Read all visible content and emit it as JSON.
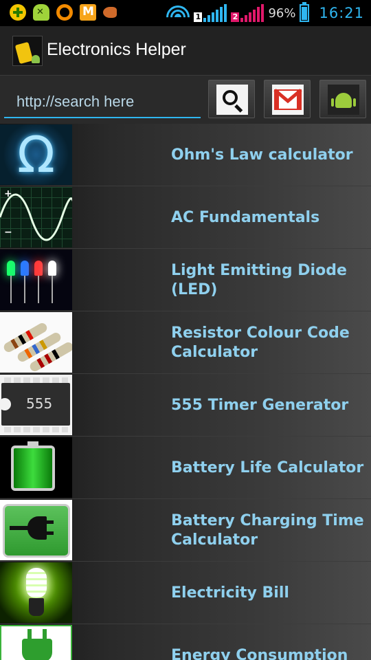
{
  "status_bar": {
    "icons": [
      "plus-icon",
      "android-debug-icon",
      "orange-ring-icon",
      "mail-icon",
      "fish-icon",
      "wifi-icon",
      "signal-1-icon",
      "signal-2-icon",
      "battery-icon"
    ],
    "sim1": "1",
    "sim2": "2",
    "battery_percent": "96%",
    "time": "16:21"
  },
  "action_bar": {
    "title": "Electronics Helper"
  },
  "search": {
    "placeholder": "http://search here",
    "value": ""
  },
  "toolbar_icons": [
    "search-icon",
    "gmail-icon",
    "android-icon"
  ],
  "list": [
    {
      "label": "Ohm's Law calculator",
      "icon": "omega-icon"
    },
    {
      "label": "AC Fundamentals",
      "icon": "sine-wave-icon"
    },
    {
      "label": "Light Emitting Diode (LED)",
      "icon": "led-icon"
    },
    {
      "label": "Resistor Colour Code Calculator",
      "icon": "resistor-icon"
    },
    {
      "label": "555 Timer Generator",
      "icon": "chip-555-icon",
      "chip_text": "555"
    },
    {
      "label": "Battery Life Calculator",
      "icon": "battery-icon"
    },
    {
      "label": "Battery Charging Time Calculator",
      "icon": "charging-plug-icon"
    },
    {
      "label": "Electricity Bill",
      "icon": "bulb-icon"
    },
    {
      "label": "Energy Consumption",
      "icon": "plug-icon"
    }
  ],
  "colors": {
    "accent": "#2fb6f0",
    "list_label": "#8fd0ee",
    "sim2": "#e0186a"
  }
}
